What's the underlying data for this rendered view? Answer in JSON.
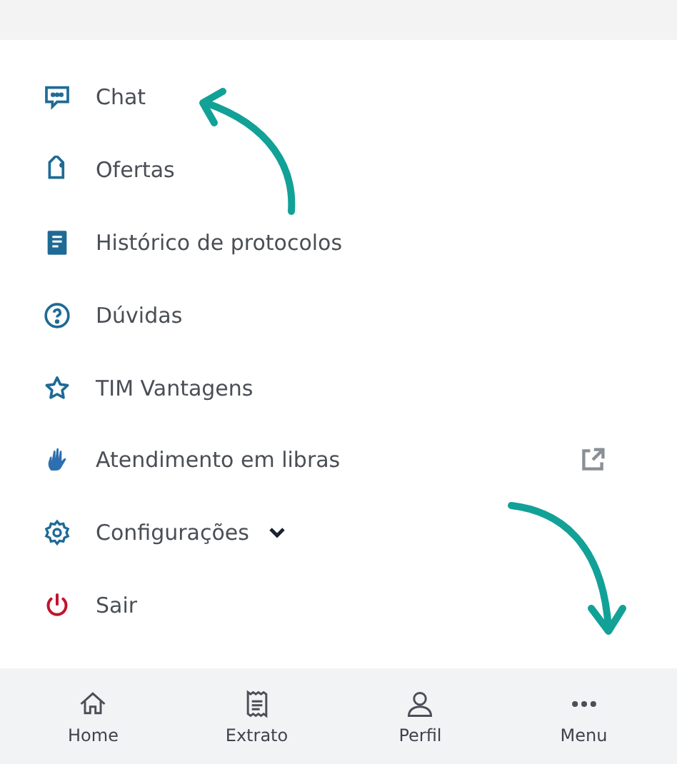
{
  "menu": [
    {
      "label": "Chat",
      "kind": "link"
    },
    {
      "label": "Ofertas",
      "kind": "link"
    },
    {
      "label": "Histórico de protocolos",
      "kind": "link"
    },
    {
      "label": "Dúvidas",
      "kind": "link"
    },
    {
      "label": "TIM Vantagens",
      "kind": "link"
    },
    {
      "label": "Atendimento em libras",
      "kind": "external"
    },
    {
      "label": "Configurações",
      "kind": "expandable",
      "expanded": false
    },
    {
      "label": "Sair",
      "kind": "danger"
    }
  ],
  "bottom_nav": [
    {
      "label": "Home"
    },
    {
      "label": "Extrato"
    },
    {
      "label": "Perfil"
    },
    {
      "label": "Menu"
    }
  ]
}
